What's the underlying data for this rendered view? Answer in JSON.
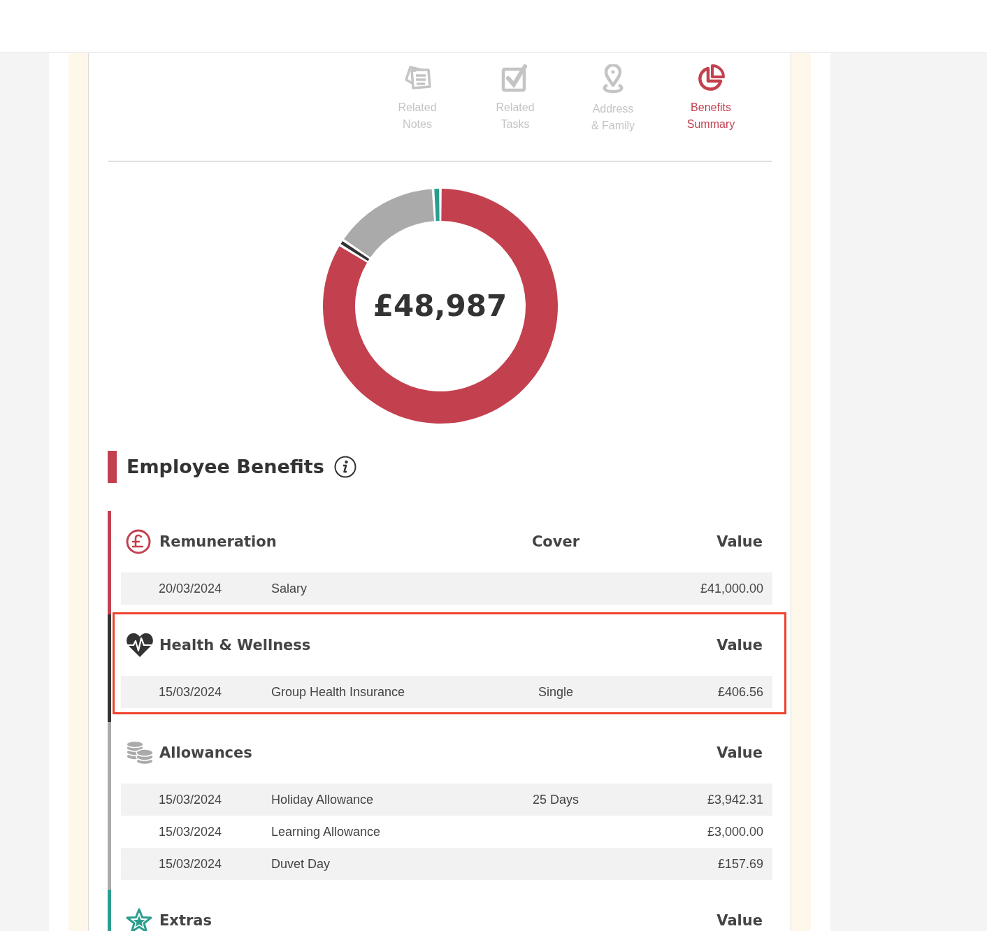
{
  "tabs": [
    {
      "lines": [
        "Related",
        "Notes"
      ],
      "kind": "notes",
      "selected": false
    },
    {
      "lines": [
        "Related",
        "Tasks"
      ],
      "kind": "tasks",
      "selected": false
    },
    {
      "lines": [
        "Address",
        "& Family"
      ],
      "kind": "address",
      "selected": false
    },
    {
      "lines": [
        "Benefits",
        "Summary"
      ],
      "kind": "benefits",
      "selected": true
    }
  ],
  "donut": {
    "total": "£48,987"
  },
  "heading": "Employee Benefits",
  "sections": [
    {
      "title": "Remuneration",
      "kind": "pound",
      "color": "#c3414f",
      "highlighted": false,
      "cover_heading": "Cover",
      "value_heading": "Value",
      "rows": [
        {
          "date": "20/03/2024",
          "name": "Salary",
          "value": "£41,000.00"
        }
      ]
    },
    {
      "title": "Health & Wellness",
      "kind": "heart",
      "color": "#333333",
      "highlighted": true,
      "value_heading": "Value",
      "rows": [
        {
          "date": "15/03/2024",
          "name": "Group Health Insurance",
          "cover": "Single",
          "value": "£406.56"
        }
      ]
    },
    {
      "title": "Allowances",
      "kind": "coins",
      "color": "#aaaaaa",
      "highlighted": false,
      "value_heading": "Value",
      "rows": [
        {
          "date": "15/03/2024",
          "name": "Holiday Allowance",
          "cover": "25 Days",
          "value": "£3,942.31"
        },
        {
          "date": "15/03/2024",
          "name": "Learning Allowance",
          "value": "£3,000.00"
        },
        {
          "date": "15/03/2024",
          "name": "Duvet Day",
          "value": "£157.69"
        }
      ]
    },
    {
      "title": "Extras",
      "kind": "star",
      "color": "#2a9d8f",
      "highlighted": false,
      "value_heading": "Value"
    }
  ]
}
